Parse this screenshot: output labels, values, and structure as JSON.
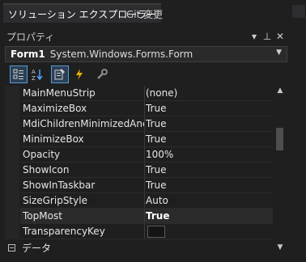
{
  "tabs": [
    {
      "label": "ソリューション エクスプローラー",
      "active": true
    },
    {
      "label": "Git 変更",
      "active": false
    }
  ],
  "panel": {
    "title": "プロパティ",
    "dropdown_glyph": "▾",
    "pin_glyph": "⊥",
    "close_glyph": "✕"
  },
  "object": {
    "name": "Form1",
    "type": "System.Windows.Forms.Form"
  },
  "toolbar": {
    "buttons": [
      "categorized-icon",
      "alphabetical-icon",
      "properties-icon",
      "events-icon",
      "property-pages-icon"
    ]
  },
  "properties": [
    {
      "name": "MainMenuStrip",
      "value": "(none)"
    },
    {
      "name": "MaximizeBox",
      "value": "True"
    },
    {
      "name": "MdiChildrenMinimizedAnchorBottom",
      "value": "True"
    },
    {
      "name": "MinimizeBox",
      "value": "True"
    },
    {
      "name": "Opacity",
      "value": "100%"
    },
    {
      "name": "ShowIcon",
      "value": "True"
    },
    {
      "name": "ShowInTaskbar",
      "value": "True"
    },
    {
      "name": "SizeGripStyle",
      "value": "Auto"
    },
    {
      "name": "TopMost",
      "value": "True",
      "bold": true,
      "selected": true
    },
    {
      "name": "TransparencyKey",
      "value": "",
      "swatch": "#151515"
    }
  ],
  "category": {
    "label": "データ"
  }
}
